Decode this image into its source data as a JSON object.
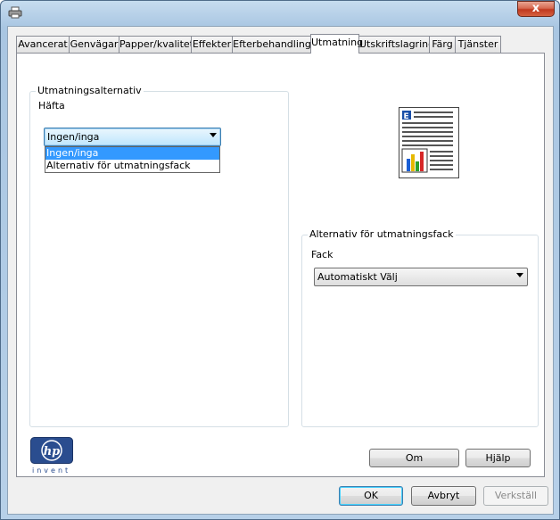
{
  "window": {
    "close_label": "x",
    "icons": {
      "title": "printer-icon",
      "close": "close-icon"
    }
  },
  "tabs": [
    {
      "label": "Avancerat",
      "active": false
    },
    {
      "label": "Genvägar",
      "active": false
    },
    {
      "label": "Papper/kvalitet",
      "active": false
    },
    {
      "label": "Effekter",
      "active": false
    },
    {
      "label": "Efterbehandling",
      "active": false
    },
    {
      "label": "Utmatning",
      "active": true
    },
    {
      "label": "Utskriftslagring",
      "active": false
    },
    {
      "label": "Färg",
      "active": false
    },
    {
      "label": "Tjänster",
      "active": false
    }
  ],
  "output_options": {
    "group_label": "Utmatningsalternativ",
    "staple_label": "Häfta",
    "staple_value": "Ingen/inga",
    "dropdown_options": [
      "Ingen/inga",
      "Alternativ för utmatningsfack"
    ],
    "selected_index": 0
  },
  "tray_options": {
    "group_label": "Alternativ för utmatningsfack",
    "tray_label": "Fack",
    "tray_value": "Automatiskt Välj"
  },
  "logo": {
    "text": "invent",
    "icon": "hp-logo-icon"
  },
  "buttons": {
    "about": "Om",
    "help": "Hjälp",
    "ok": "OK",
    "cancel": "Avbryt",
    "apply": "Verkställ"
  },
  "colors": {
    "selection": "#3399ff",
    "chart_bars": [
      "#1a5fd6",
      "#e6b800",
      "#2ca02c",
      "#d62728"
    ]
  }
}
